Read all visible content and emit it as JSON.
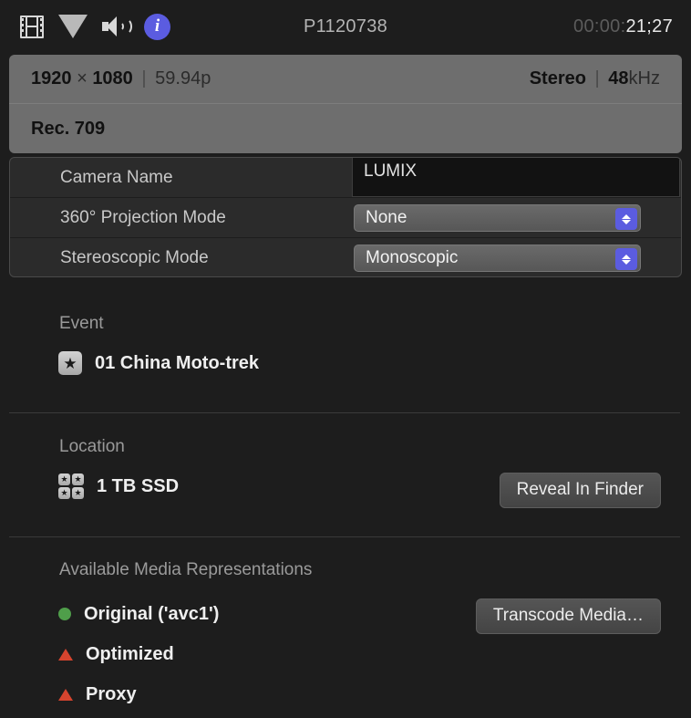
{
  "toolbar": {
    "icons": [
      {
        "name": "filmstrip-icon",
        "label": "Video"
      },
      {
        "name": "triangle-icon",
        "label": "Color"
      },
      {
        "name": "speaker-icon",
        "label": "Audio"
      },
      {
        "name": "info-icon",
        "label": "Info"
      }
    ],
    "info_glyph": "i",
    "clip_title": "P1120738",
    "timecode": {
      "dim": "00:00:",
      "lit": "21;27",
      "full": "00:00:21;27"
    }
  },
  "banner": {
    "resolution_width": "1920",
    "resolution_times": "×",
    "resolution_height": "1080",
    "separator": "|",
    "frame_rate": "59.94p",
    "audio_channels": "Stereo",
    "audio_rate_value": "48",
    "audio_rate_unit": "kHz",
    "color_space": "Rec. 709"
  },
  "form": {
    "rows": [
      {
        "label": "Camera Name",
        "value": "LUMIX",
        "control": "textfield"
      },
      {
        "label": "360° Projection Mode",
        "value": "None",
        "control": "popup"
      },
      {
        "label": "Stereoscopic Mode",
        "value": "Monoscopic",
        "control": "popup"
      }
    ]
  },
  "event": {
    "title": "Event",
    "icon": "star-icon",
    "icon_glyph": "★",
    "name": "01 China Moto-trek"
  },
  "location": {
    "title": "Location",
    "icon": "drive-icon",
    "icon_glyph": "★",
    "name": "1 TB SSD",
    "button_label": "Reveal In Finder"
  },
  "media": {
    "title": "Available Media Representations",
    "button_label": "Transcode Media…",
    "items": [
      {
        "label": "Original ('avc1')",
        "status": "available",
        "marker": "dot"
      },
      {
        "label": "Optimized",
        "status": "unavailable",
        "marker": "triangle"
      },
      {
        "label": "Proxy",
        "status": "unavailable",
        "marker": "triangle"
      }
    ]
  },
  "colors": {
    "accent": "#5b5ce0",
    "available": "#4f9e4a",
    "unavailable": "#d6442e",
    "banner_bg": "#6e6e6e",
    "window_bg": "#1d1d1d"
  }
}
